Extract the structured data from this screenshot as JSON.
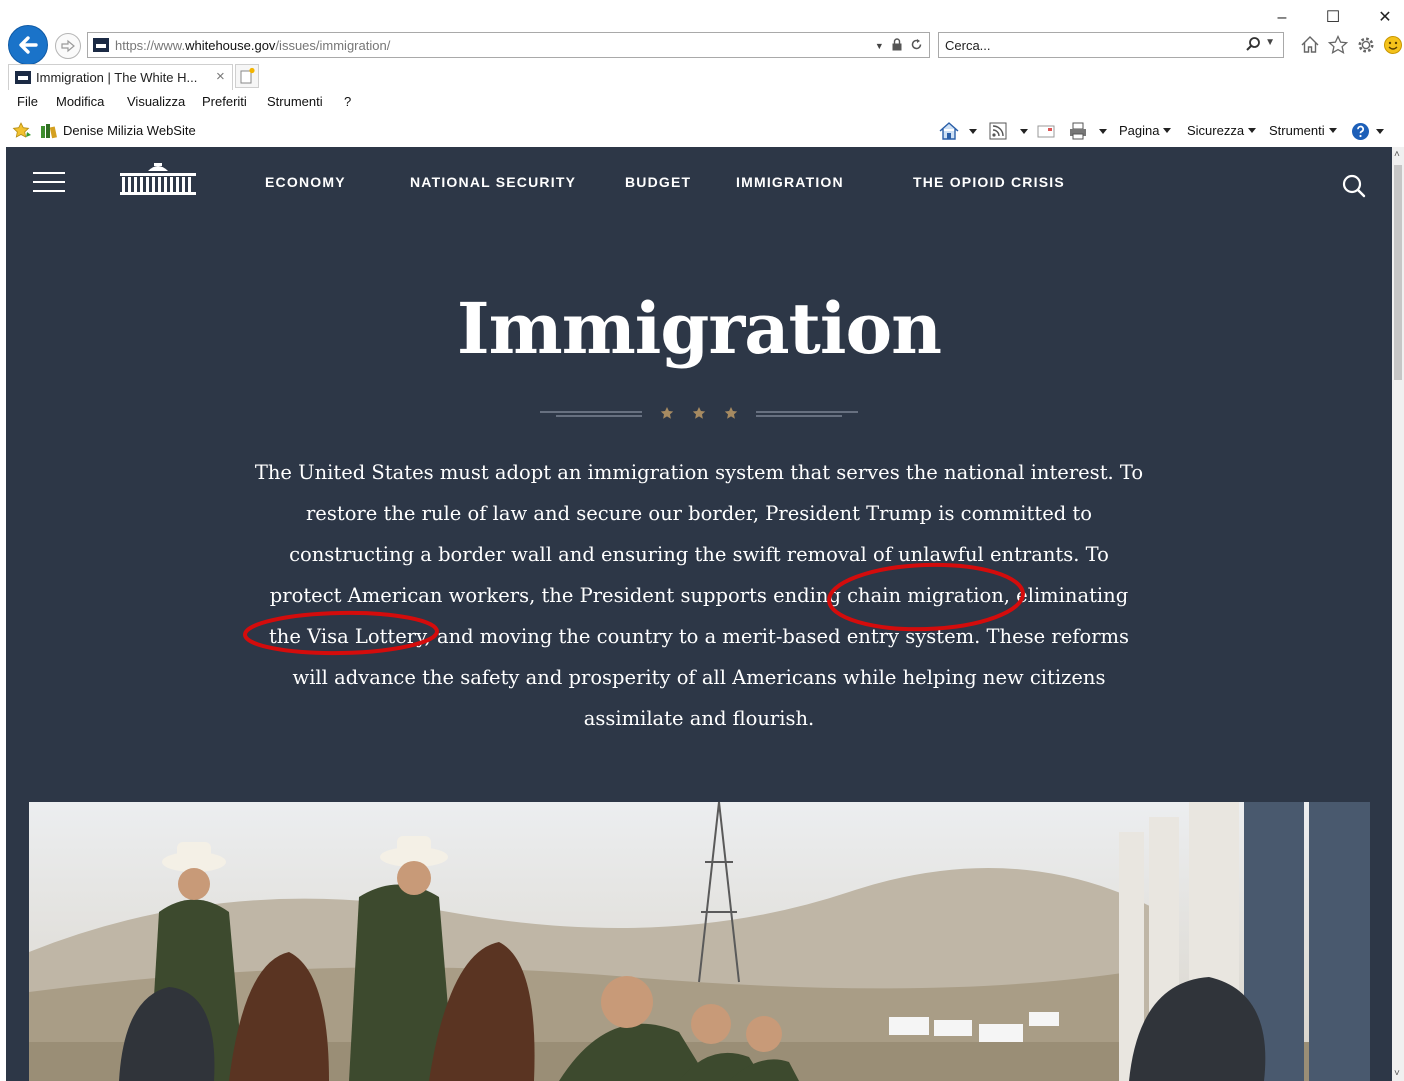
{
  "browser": {
    "address": {
      "scheme": "https://",
      "prefix": "www.",
      "host": "whitehouse.gov",
      "path": "/issues/immigration/"
    },
    "search": {
      "placeholder": "Cerca..."
    },
    "tab": {
      "label": "Immigration | The White H...",
      "close": "×"
    },
    "window_controls": {
      "minimize": "–",
      "maximize": "☐",
      "close": "✕"
    },
    "menu": [
      "File",
      "Modifica",
      "Visualizza",
      "Preferiti",
      "Strumenti",
      "?"
    ],
    "favorites": {
      "item": "Denise Milizia WebSite"
    },
    "commands": {
      "page": "Pagina",
      "security": "Sicurezza",
      "tools": "Strumenti"
    }
  },
  "site": {
    "nav": [
      "ECONOMY",
      "NATIONAL SECURITY",
      "BUDGET",
      "IMMIGRATION",
      "THE OPIOID CRISIS"
    ],
    "title": "Immigration",
    "intro": "The United States must adopt an immigration system that serves the national interest. To restore the rule of law and secure our border, President Trump is committed to constructing a border wall and ensuring the swift removal of unlawful entrants. To protect American workers, the President supports ending chain migration, eliminating the Visa Lottery, and moving the country to a merit-based entry system. These reforms will advance the safety and prosperity of all Americans while helping new citizens assimilate and flourish."
  },
  "colors": {
    "page_bg": "#2d3747",
    "accent_star": "#a68a61",
    "annotation": "#d40c0c",
    "ie_blue": "#1a73c9"
  },
  "icons": [
    "back-arrow-icon",
    "forward-arrow-icon",
    "lock-icon",
    "refresh-icon",
    "search-icon",
    "home-icon",
    "favorites-star-icon",
    "gear-icon",
    "smiley-icon",
    "rss-feed-icon",
    "mail-icon",
    "print-icon",
    "help-icon",
    "hamburger-menu-icon",
    "white-house-logo-icon"
  ]
}
